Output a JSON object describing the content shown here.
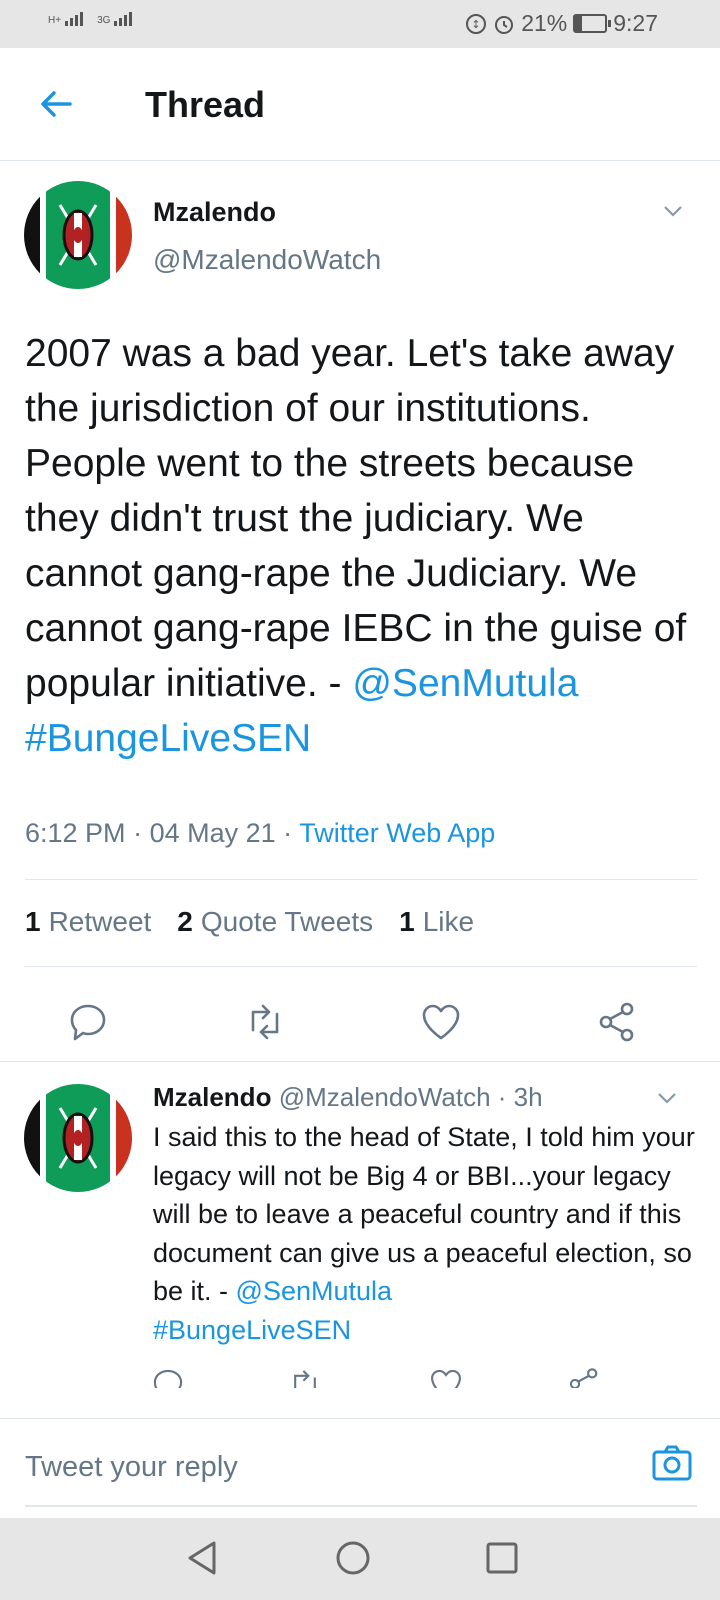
{
  "status_bar": {
    "network_1": "H+",
    "network_2": "3G",
    "battery": "21%",
    "time": "9:27"
  },
  "header": {
    "title": "Thread"
  },
  "main_tweet": {
    "name": "Mzalendo",
    "handle": "@MzalendoWatch",
    "text": "2007 was a bad year. Let's take away the jurisdiction of our institutions. People went to the streets because they didn't trust the judiciary. We cannot gang-rape the Judiciary. We cannot gang-rape IEBC in the guise of popular initiative. - ",
    "mention": "@SenMutula",
    "hashtag": "#BungeLiveSEN",
    "time": "6:12 PM",
    "date": "04 May 21",
    "source": "Twitter Web App",
    "stats": [
      {
        "count": "1",
        "label": "Retweet"
      },
      {
        "count": "2",
        "label": "Quote Tweets"
      },
      {
        "count": "1",
        "label": "Like"
      }
    ]
  },
  "reply_tweet": {
    "name": "Mzalendo",
    "handle": "@MzalendoWatch",
    "age": "3h",
    "text": "I said this to the head of State, I told him your legacy will not be Big 4 or BBI...your legacy will be to leave a peaceful country and if this document can give us a peaceful election, so be it. - ",
    "mention": "@SenMutula",
    "hashtag": "#BungeLiveSEN"
  },
  "composer": {
    "placeholder": "Tweet your reply"
  },
  "colors": {
    "accent": "#1b95e0",
    "secondary_text": "#657786",
    "divider": "#e1e8ed"
  },
  "icons": [
    "back-arrow-icon",
    "chevron-down-icon",
    "reply-icon",
    "retweet-icon",
    "like-icon",
    "share-icon",
    "camera-icon",
    "nav-back-icon",
    "nav-home-icon",
    "nav-recents-icon"
  ]
}
